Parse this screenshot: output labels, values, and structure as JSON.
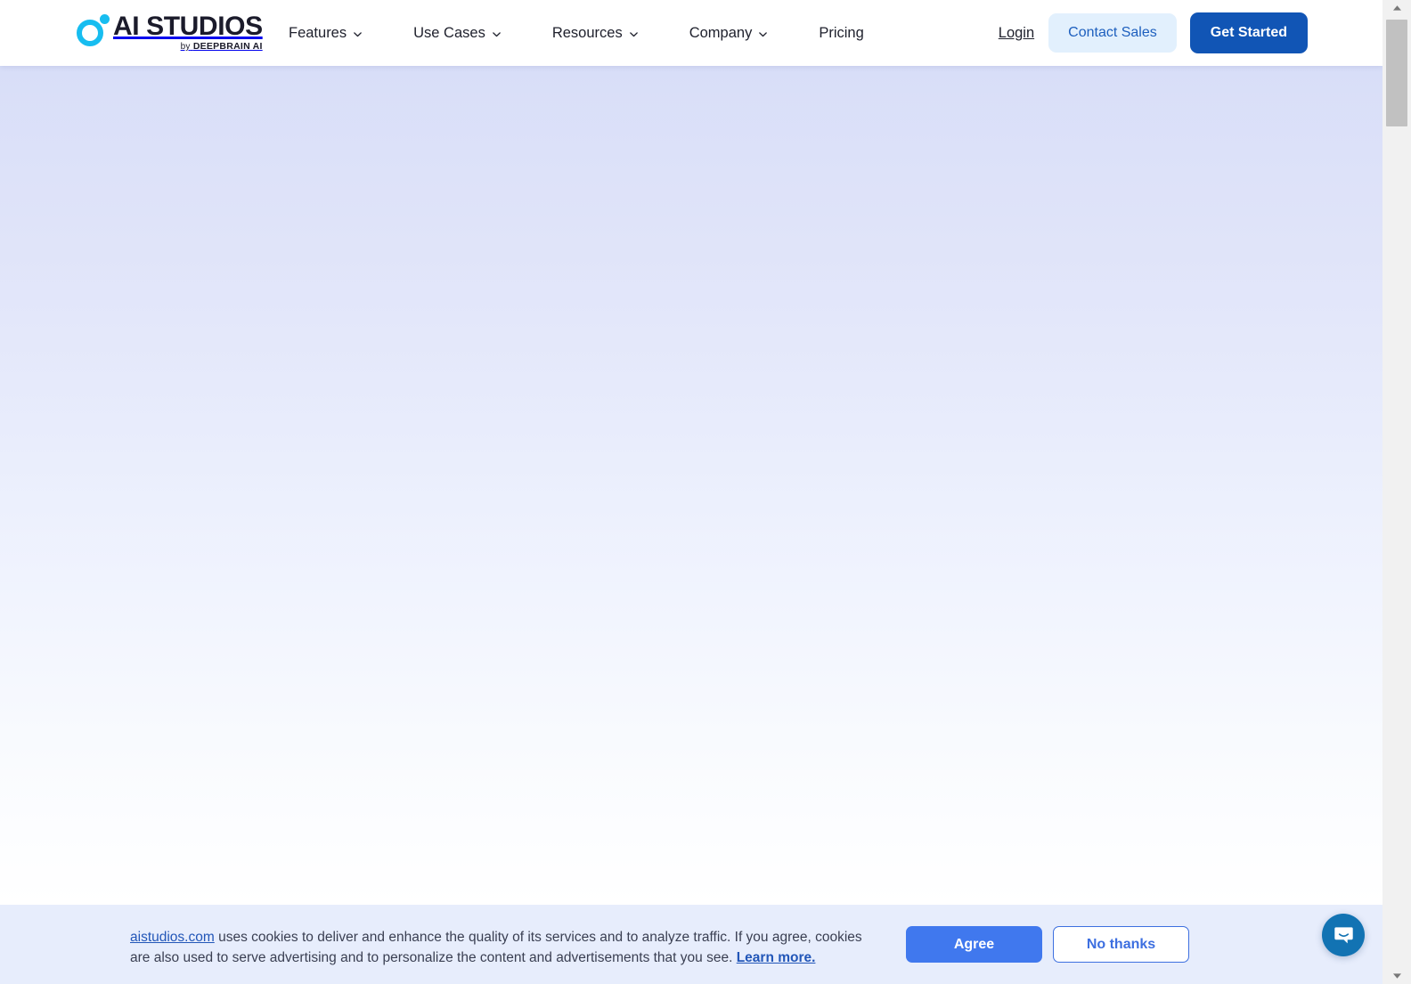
{
  "header": {
    "logo": {
      "name": "AI STUDIOS",
      "by_word": "by",
      "parent_brand": "DEEPBRAIN AI",
      "mark_color": "#17bdf0"
    },
    "nav_items": [
      {
        "label": "Features",
        "has_dropdown": true,
        "icon": "chevron-down-icon"
      },
      {
        "label": "Use Cases",
        "has_dropdown": true,
        "icon": "chevron-down-icon"
      },
      {
        "label": "Resources",
        "has_dropdown": true,
        "icon": "chevron-down-icon"
      },
      {
        "label": "Company",
        "has_dropdown": true,
        "icon": "chevron-down-icon"
      },
      {
        "label": "Pricing",
        "has_dropdown": false,
        "icon": ""
      }
    ],
    "login_label": "Login",
    "contact_sales_label": "Contact Sales",
    "get_started_label": "Get Started",
    "contact_sales_bg": "#e2f0fd",
    "contact_sales_color": "#1d5fbe",
    "get_started_bg": "#1155b5"
  },
  "hero": {
    "background_top_color": "#d8def8",
    "background_bottom_color": "#ffffff"
  },
  "cookie_banner": {
    "domain_link": "aistudios.com",
    "body_part1": " uses cookies to deliver and enhance the quality of its services and to analyze traffic. If you agree, cookies are also used to serve advertising and to personalize the content and advertisements that you see. ",
    "learn_more_label": "Learn more.",
    "agree_label": "Agree",
    "no_thanks_label": "No thanks",
    "background": "#e7edfc",
    "agree_bg": "#4078ee",
    "no_thanks_color": "#3d6fe0"
  },
  "chat": {
    "icon": "chat-bubble-smile-icon",
    "background": "#1273b3"
  },
  "scrollbar": {
    "up_icon": "caret-up-icon",
    "down_icon": "caret-down-icon",
    "track_color": "#f1f1f1",
    "thumb_color": "#c1c1c1"
  }
}
